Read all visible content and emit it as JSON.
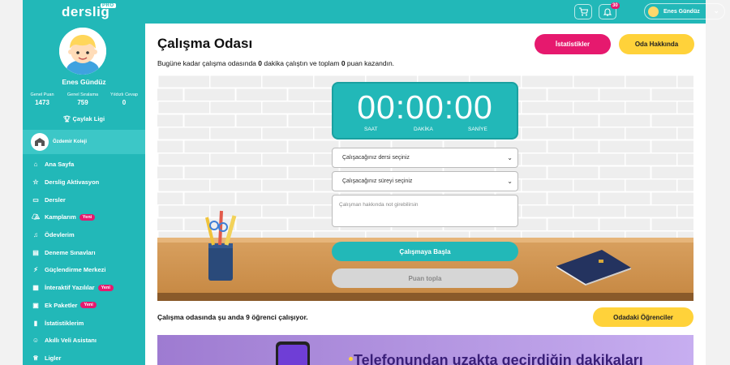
{
  "brand": {
    "logo": "derslig",
    "tier": "PRO"
  },
  "topbar": {
    "notification_count": "30",
    "user_name": "Enes Gündüz"
  },
  "profile": {
    "name": "Enes Gündüz",
    "stats": [
      {
        "label": "Genel Puan",
        "value": "1473"
      },
      {
        "label": "Genel Sıralama",
        "value": "759"
      },
      {
        "label": "Yıldızlı Cevap",
        "value": "0"
      }
    ],
    "league": "Çaylak Ligi",
    "school": "Özdemir Koleji"
  },
  "menu": [
    {
      "label": "Ana Sayfa",
      "icon": "home-icon"
    },
    {
      "label": "Derslig Aktivasyon",
      "icon": "star-icon"
    },
    {
      "label": "Dersler",
      "icon": "book-icon"
    },
    {
      "label": "Kamplarım",
      "icon": "tent-icon",
      "badge": "Yeni"
    },
    {
      "label": "Ödevlerim",
      "icon": "bell-icon"
    },
    {
      "label": "Deneme Sınavları",
      "icon": "exam-icon"
    },
    {
      "label": "Güçlendirme Merkezi",
      "icon": "bolt-icon"
    },
    {
      "label": "İnteraktif Yazılılar",
      "icon": "doc-icon",
      "badge": "Yeni"
    },
    {
      "label": "Ek Paketler",
      "icon": "package-icon",
      "badge": "Yeni"
    },
    {
      "label": "İstatistiklerim",
      "icon": "chart-icon"
    },
    {
      "label": "Akıllı Veli Asistanı",
      "icon": "assistant-icon"
    },
    {
      "label": "Ligler",
      "icon": "trophy-icon"
    }
  ],
  "main": {
    "title": "Çalışma Odası",
    "subtitle_parts": [
      "Bugüne kadar çalışma odasında ",
      "0",
      " dakika çalıştın ve toplam ",
      "0",
      " puan kazandın."
    ],
    "stats_button": "İstatistikler",
    "room_button": "Oda Hakkında",
    "timer": {
      "display": "00:00:00",
      "labels": [
        "SAAT",
        "DAKİKA",
        "SANİYE"
      ]
    },
    "subject_select": "Çalışacağınız dersi seçiniz",
    "duration_select": "Çalışacağınız süreyi seçiniz",
    "note_placeholder": "Çalışman hakkında not girebilirsin",
    "start_button": "Çalışmaya Başla",
    "collect_button": "Puan topla",
    "students_text": "Çalışma odasında şu anda 9 öğrenci çalışıyor.",
    "students_button": "Odadaki Öğrenciler",
    "banner_text": "Telefonundan uzakta geçirdiğin dakikaları"
  },
  "colors": {
    "accent": "#22b8b8",
    "pink": "#e6196e",
    "yellow": "#ffd23a"
  }
}
